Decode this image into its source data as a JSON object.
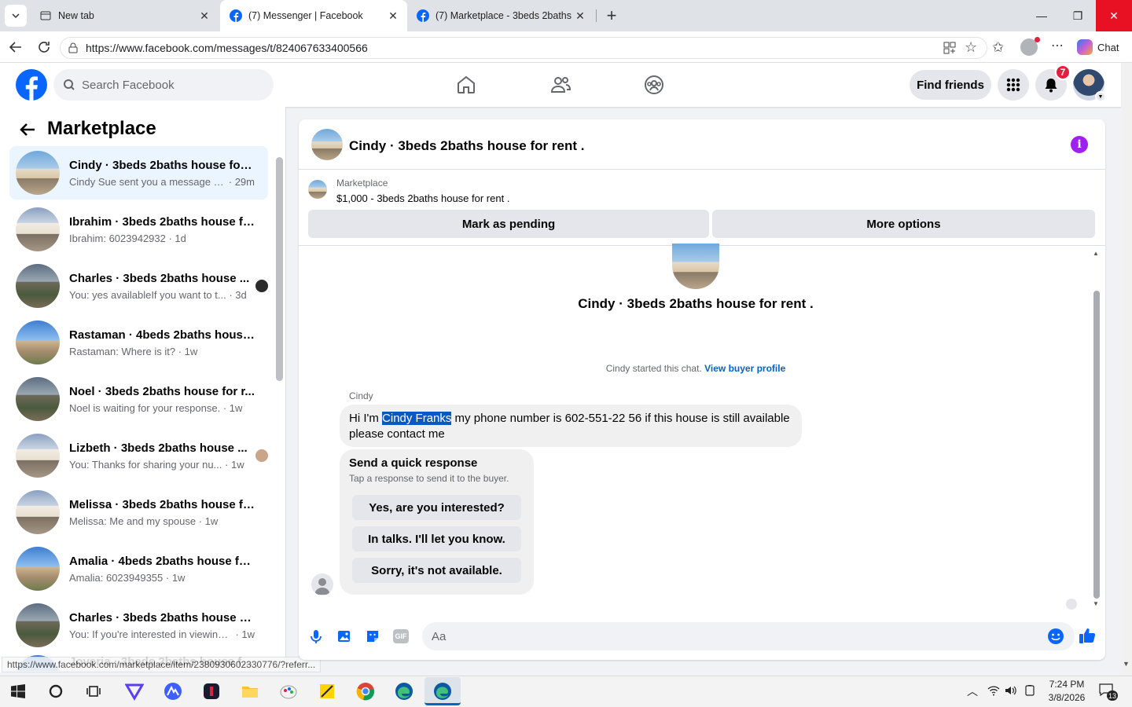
{
  "browser": {
    "tabs": [
      {
        "label": "New tab"
      },
      {
        "label": "(7) Messenger | Facebook"
      },
      {
        "label": "(7) Marketplace - 3beds 2baths ho"
      }
    ],
    "url": "https://www.facebook.com/messages/t/824067633400566",
    "chat_label": "Chat",
    "status_url": "https://www.facebook.com/marketplace/item/2380930602330776/?referr..."
  },
  "fb_header": {
    "search_placeholder": "Search Facebook",
    "find_friends": "Find friends",
    "notification_count": "7"
  },
  "sidebar": {
    "title": "Marketplace",
    "conversations": [
      {
        "name": "Cindy · 3beds 2baths house for r...",
        "preview": "Cindy Sue sent you a message ab...",
        "time": "· 29m",
        "selected": true,
        "thumb": "house"
      },
      {
        "name": "Ibrahim · 3beds 2baths house fo...",
        "preview": "Ibrahim: 6023942932",
        "time": " · 1d",
        "thumb": "house2"
      },
      {
        "name": "Charles · 3beds 2baths house ...",
        "preview": "You: yes availableIf you want to t...",
        "time": " · 3d",
        "thumb": "house3"
      },
      {
        "name": "Rastaman · 4beds 2baths house ...",
        "preview": "Rastaman: Where is it?",
        "time": " · 1w",
        "thumb": "house4"
      },
      {
        "name": "Noel · 3beds 2baths house for r...",
        "preview": "Noel is waiting for your response.",
        "time": " · 1w",
        "thumb": "house3"
      },
      {
        "name": "Lizbeth · 3beds 2baths house ...",
        "preview": "You: Thanks for sharing your nu...",
        "time": " · 1w",
        "thumb": "house2"
      },
      {
        "name": "Melissa · 3beds 2baths house fo...",
        "preview": "Melissa: Me and my spouse",
        "time": " · 1w",
        "thumb": "house2"
      },
      {
        "name": "Amalia · 4beds 2baths house for...",
        "preview": "Amalia: 6023949355",
        "time": " · 1w",
        "thumb": "house4"
      },
      {
        "name": "Charles · 3beds 2baths house fo...",
        "preview": "You: If you're interested in viewing ...",
        "time": " · 1w",
        "thumb": "house3"
      },
      {
        "name": "Joveria · 3beds 2baths house for...",
        "preview": "",
        "time": "",
        "thumb": "house4"
      }
    ]
  },
  "chat": {
    "title": "Cindy · 3beds 2baths house for rent .",
    "listing_source": "Marketplace",
    "listing_price_title": "$1,000 - 3beds 2baths house for rent .",
    "mark_pending": "Mark as pending",
    "more_options": "More options",
    "profile_name": "Cindy · 3beds 2baths house for rent .",
    "started_text": "Cindy started this chat.",
    "view_buyer": "View buyer profile",
    "sender": "Cindy",
    "message_pre": "Hi I'm ",
    "message_highlight": "Cindy Franks",
    "message_post": " my phone number is 602-551-22 56 if this house is still available please contact me",
    "quick_title": "Send a quick response",
    "quick_sub": "Tap a response to send it to the buyer.",
    "quick_responses": [
      "Yes, are you interested?",
      "In talks. I'll let you know.",
      "Sorry, it's not available."
    ],
    "composer_placeholder": "Aa"
  },
  "taskbar": {
    "time": "7:24 PM",
    "date": "3/8/2026",
    "notif_count": "13"
  },
  "colors": {
    "fb_blue": "#0866ff",
    "link": "#0064d1",
    "selected_row": "#ebf5ff",
    "highlight": "#0a58c2",
    "info_purple": "#a020f0",
    "badge_red": "#e41e3f"
  }
}
